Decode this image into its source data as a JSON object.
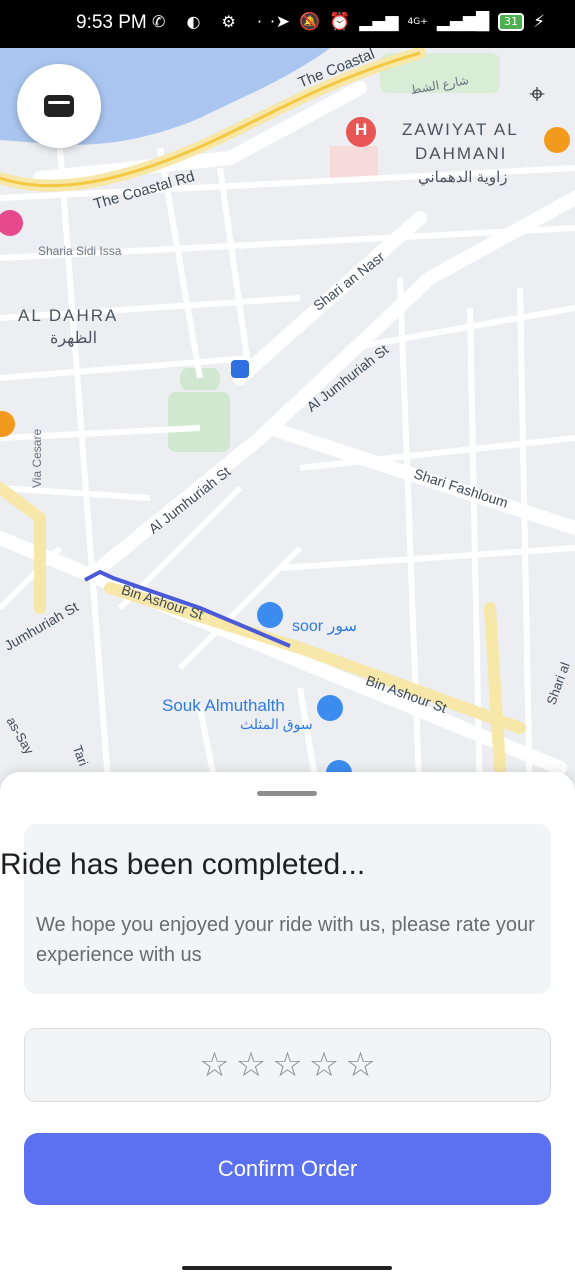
{
  "status_bar": {
    "time": "9:53 PM",
    "left_icons": "✆ ◐ ⚙ ···",
    "location_icon": "➤",
    "mute_icon": "🔕",
    "alarm_icon": "⏰",
    "signal1": "▂▄▆",
    "network": "4G+",
    "signal2": "▂▄▆█",
    "battery": "31",
    "charging_icon": "⚡"
  },
  "map": {
    "labels": {
      "coastal_rd_1": "The Coastal Rd",
      "coastal_rd_2": "The Coastal",
      "sidi_issa": "Sharia Sidi Issa",
      "al_dahra": "AL DAHRA",
      "al_dahra_ar": "الظهرة",
      "zawiyat_1": "ZAWIYAT AL",
      "zawiyat_2": "DAHMANI",
      "zawiyat_ar": "زاوية الدهماني",
      "shari_an_nasr": "Shari an Nasr",
      "al_jumhuriah_st_1": "Al Jumhuriah St",
      "al_jumhuriah_st_2": "Al Jumhuriah St",
      "jumhuriah_st": "Jumhuriah St",
      "shari_fashloum": "Shari Fashloum",
      "via_cesare": "Via Cesare",
      "bin_ashour_st_1": "Bin Ashour St",
      "bin_ashour_st_2": "Bin Ashour St",
      "soor": "soor سور",
      "souk": "Souk Almuthalth",
      "souk_ar": "سوق المثلث",
      "shari_al": "Shari al",
      "as_say": "as-Say",
      "tari": "Tari",
      "shari_ar_shatt": "شارع الشط"
    },
    "wallet_icon": "wallet-icon",
    "locate_icon": "⌖",
    "hospital_icon": "H",
    "accent_route": "#4a5ad8"
  },
  "sheet": {
    "title": "Ride has been completed...",
    "subtitle": "We hope you enjoyed your ride with us, please rate your experience with us",
    "stars": [
      "☆",
      "☆",
      "☆",
      "☆",
      "☆"
    ],
    "confirm_label": "Confirm Order",
    "confirm_color": "#5b71f2"
  }
}
